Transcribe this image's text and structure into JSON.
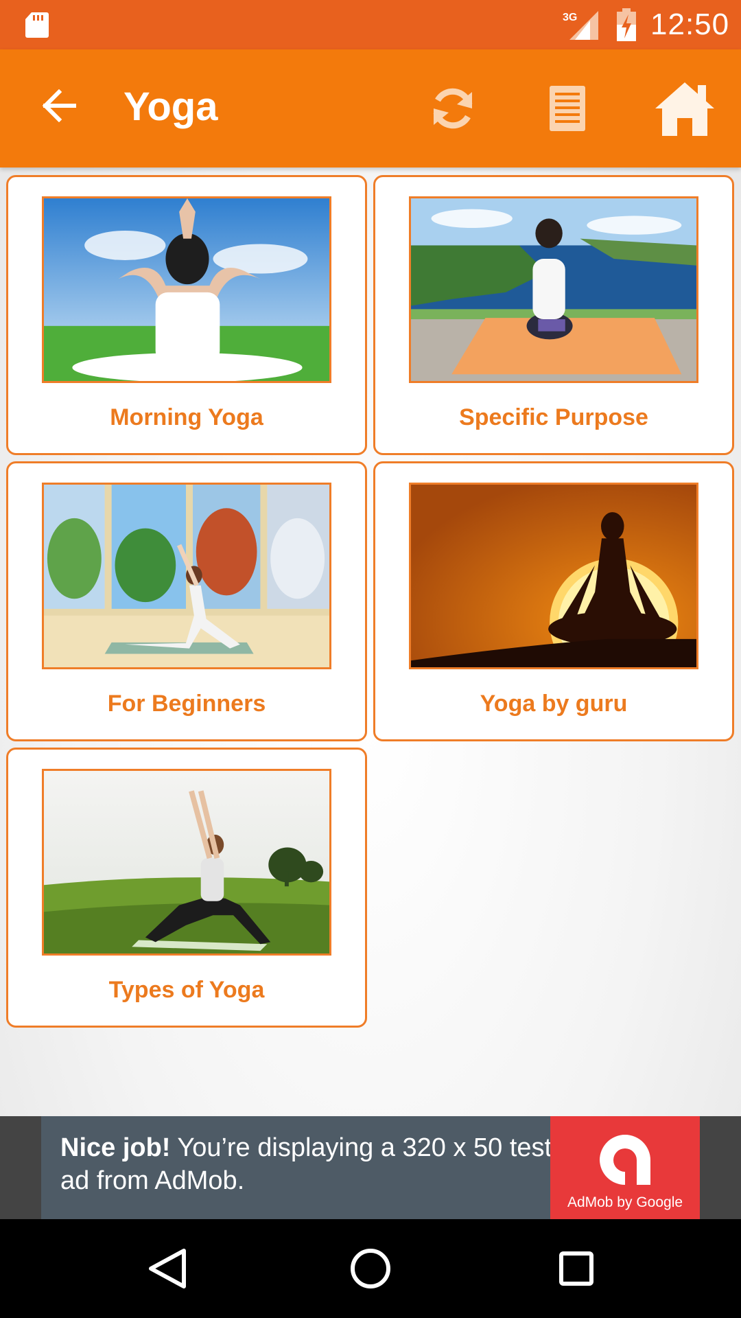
{
  "status_bar": {
    "time": "12:50",
    "network": "3G",
    "icons": [
      "sd-card-icon",
      "signal-icon",
      "battery-charging-icon"
    ]
  },
  "app_bar": {
    "title": "Yoga",
    "actions": [
      "back-arrow-icon",
      "refresh-icon",
      "list-icon",
      "home-icon"
    ]
  },
  "colors": {
    "status_bar": "#e8611e",
    "app_bar": "#f37a0c",
    "accent": "#ef7d28",
    "label": "#ec7a1e",
    "ad_background": "#4e5b66",
    "ad_logo": "#e8393a"
  },
  "categories": [
    {
      "label": "Morning Yoga",
      "image": "woman seated in meditation with raised joined hands, sky and grass"
    },
    {
      "label": "Specific Purpose",
      "image": "woman kneeling on orange mat facing coastline"
    },
    {
      "label": "For Beginners",
      "image": "illustrated woman stretching on mat before seasonal windows"
    },
    {
      "label": "Yoga by guru",
      "image": "silhouette in lotus pose against setting sun"
    },
    {
      "label": "Types of Yoga",
      "image": "woman in warrior pose on grassy field"
    }
  ],
  "ad": {
    "headline": "Nice job!",
    "body": " You’re displaying a 320 x 50 test ad from AdMob.",
    "logo_text": "AdMob by Google"
  },
  "nav_bar": {
    "buttons": [
      "nav-back-icon",
      "nav-home-icon",
      "nav-recents-icon"
    ]
  }
}
